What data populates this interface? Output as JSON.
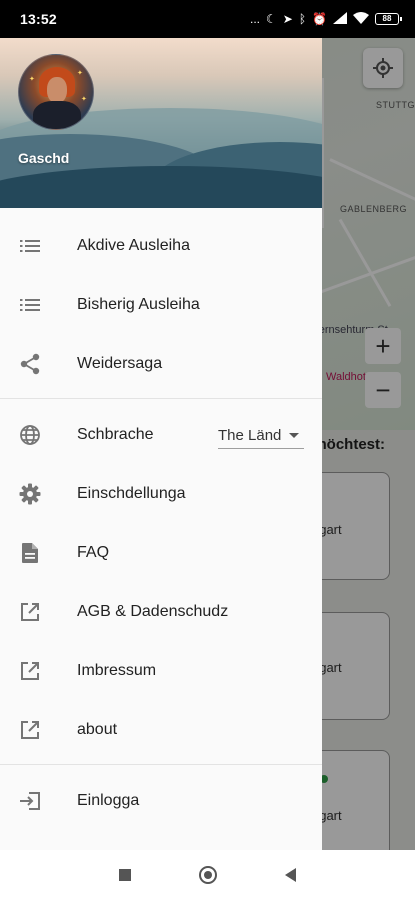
{
  "status_bar": {
    "time": "13:52",
    "dots": "...",
    "battery": "88"
  },
  "drawer": {
    "user": {
      "name": "Gaschd"
    },
    "items": [
      {
        "id": "active",
        "label": "Akdive Ausleiha",
        "icon": "list-icon"
      },
      {
        "id": "previous",
        "label": "Bisherig Ausleiha",
        "icon": "list-icon"
      },
      {
        "id": "share",
        "label": "Weidersaga",
        "icon": "share-icon"
      }
    ],
    "language": {
      "label": "Schbrache",
      "icon": "globe-icon",
      "selected": "The Länd"
    },
    "items2": [
      {
        "id": "settings",
        "label": "Einschdellunga",
        "icon": "gear-icon"
      },
      {
        "id": "faq",
        "label": "FAQ",
        "icon": "document-icon"
      },
      {
        "id": "terms",
        "label": "AGB & Dadenschudz",
        "icon": "external-link-icon"
      },
      {
        "id": "imprint",
        "label": "Imbressum",
        "icon": "external-link-icon"
      },
      {
        "id": "about",
        "label": "about",
        "icon": "external-link-icon"
      }
    ],
    "login": {
      "label": "Einlogga",
      "icon": "login-icon"
    }
  },
  "background": {
    "map_labels": {
      "stuttgart": "STUTTGART",
      "gablenberg": "GABLENBERG",
      "tower": "Fernsehturm St",
      "hotel": "Waldhotel Stu"
    },
    "zoom_in": "+",
    "zoom_out": "−",
    "heading": "n möchtest:",
    "cards": [
      {
        "text": "ttgart"
      },
      {
        "text": "ttgart"
      },
      {
        "text": "ttgart"
      }
    ]
  },
  "colors": {
    "drawer_bg": "#fafafa",
    "icon_gray": "#757575",
    "text": "#222222",
    "scrim": "rgba(0,0,0,0.4)"
  }
}
